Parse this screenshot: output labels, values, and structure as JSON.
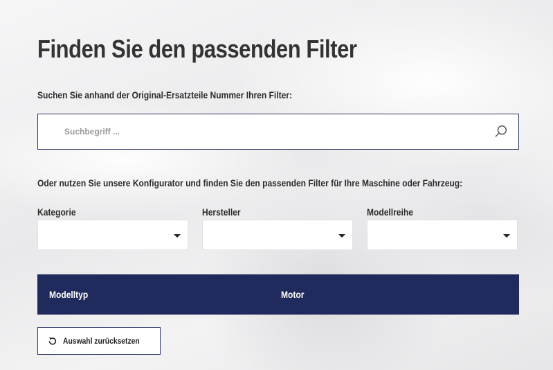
{
  "page": {
    "title": "Finden Sie den passenden Filter"
  },
  "search": {
    "label": "Suchen Sie anhand der Original-Ersatzteile Nummer Ihren Filter:",
    "placeholder": "Suchbegriff ...",
    "value": "",
    "icon": "search-icon"
  },
  "configurator": {
    "intro": "Oder nutzen Sie unsere Konfigurator und finden Sie den passenden Filter für Ihre Maschine oder Fahrzeug:",
    "selects": [
      {
        "label": "Kategorie",
        "value": ""
      },
      {
        "label": "Hersteller",
        "value": ""
      },
      {
        "label": "Modellreihe",
        "value": ""
      }
    ]
  },
  "results_table": {
    "columns": [
      "Modelltyp",
      "Motor"
    ]
  },
  "reset": {
    "label": "Auswahl zurücksetzen",
    "icon": "reset-icon"
  },
  "colors": {
    "accent": "#212a5c",
    "border": "#2a3566",
    "text": "#2c2c2c"
  }
}
